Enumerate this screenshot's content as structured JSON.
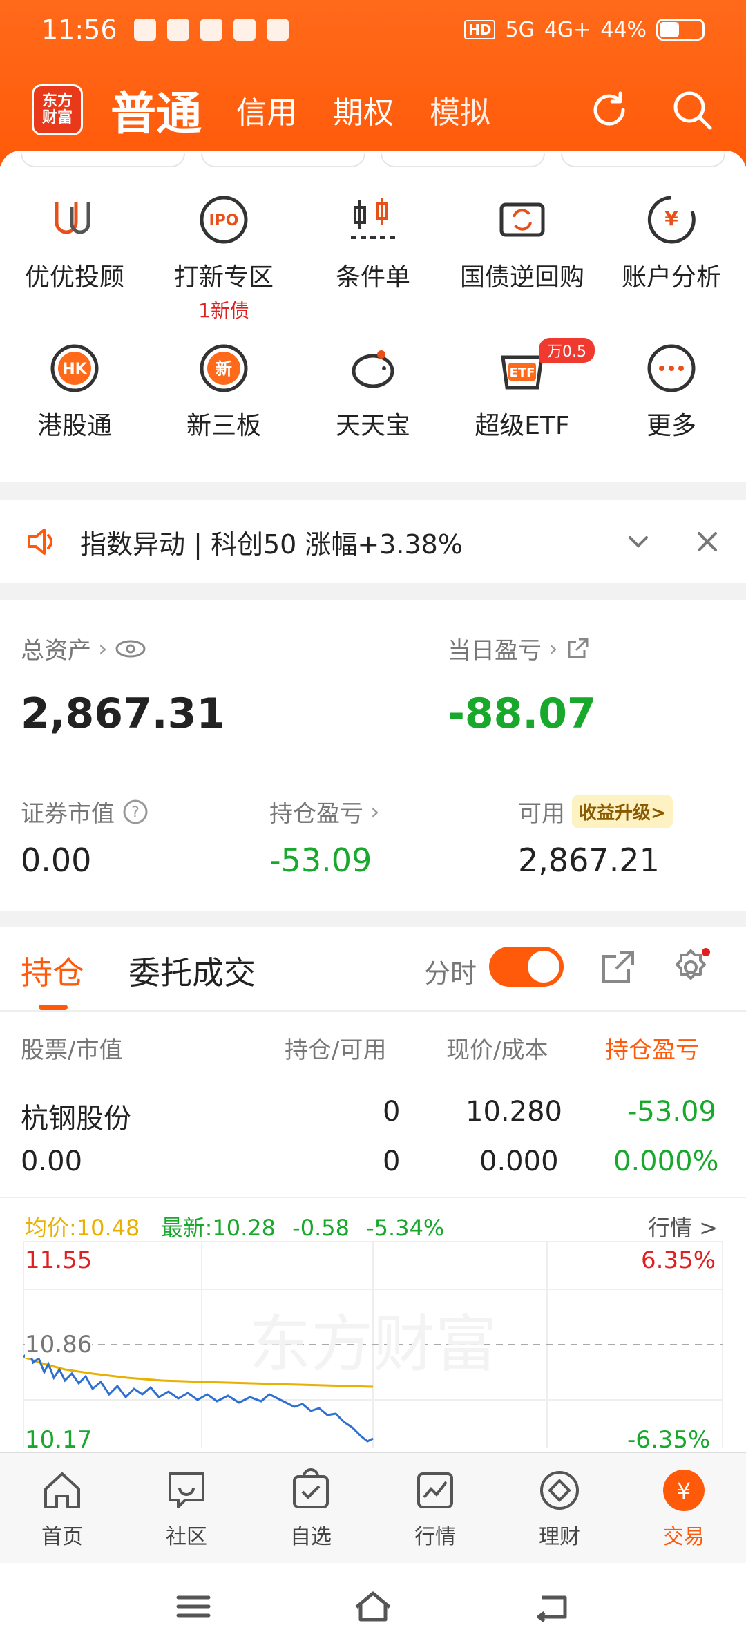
{
  "status_bar": {
    "time": "11:56",
    "network_hd": "HD",
    "network_5g": "5G",
    "network_4g": "4G+",
    "battery": "44%"
  },
  "header": {
    "logo_line1": "东方",
    "logo_line2": "财富",
    "tabs": [
      "普通",
      "信用",
      "期权",
      "模拟"
    ]
  },
  "features": [
    {
      "label": "优优投顾",
      "icon": "uu-advisor-icon"
    },
    {
      "label": "打新专区",
      "sub": "1新债",
      "icon": "ipo-icon"
    },
    {
      "label": "条件单",
      "icon": "candlestick-icon"
    },
    {
      "label": "国债逆回购",
      "icon": "repo-icon"
    },
    {
      "label": "账户分析",
      "icon": "yuan-chart-icon"
    },
    {
      "label": "港股通",
      "icon": "hk-icon"
    },
    {
      "label": "新三板",
      "icon": "new-board-icon"
    },
    {
      "label": "天天宝",
      "icon": "piggy-bank-icon"
    },
    {
      "label": "超级ETF",
      "badge": "万0.5",
      "icon": "etf-icon"
    },
    {
      "label": "更多",
      "icon": "more-icon"
    }
  ],
  "notice": {
    "text": "指数异动 | 科创50 涨幅+3.38%"
  },
  "assets": {
    "total_label": "总资产",
    "total_value": "2,867.31",
    "daily_label": "当日盈亏",
    "daily_value": "-88.07",
    "market_value_label": "证券市值",
    "market_value": "0.00",
    "position_pl_label": "持仓盈亏",
    "position_pl": "-53.09",
    "available_label": "可用",
    "available_value": "2,867.21",
    "upgrade_label": "收益升级>"
  },
  "positions": {
    "tab_active": "持仓",
    "tab_inactive": "委托成交",
    "toggle_label": "分时",
    "columns": [
      "股票/市值",
      "持仓/可用",
      "现价/成本",
      "持仓盈亏"
    ],
    "row": {
      "name": "杭钢股份",
      "market_value": "0.00",
      "holding": "0",
      "available": "0",
      "price": "10.280",
      "cost": "0.000",
      "pl": "-53.09",
      "pl_pct": "0.000%"
    }
  },
  "minichart": {
    "avg_label": "均价:",
    "avg_value": "10.48",
    "latest_label": "最新:",
    "latest_value": "10.28",
    "change": "-0.58",
    "change_pct": "-5.34%",
    "market_link": "行情 >",
    "top_price": "11.55",
    "top_pct": "6.35%",
    "mid_price": "10.86",
    "bottom_price": "10.17",
    "bottom_pct": "-6.35%",
    "watermark": "东方财富"
  },
  "bottom_nav": [
    {
      "label": "首页",
      "icon": "home-icon"
    },
    {
      "label": "社区",
      "icon": "community-icon"
    },
    {
      "label": "自选",
      "icon": "watchlist-icon"
    },
    {
      "label": "行情",
      "icon": "market-icon"
    },
    {
      "label": "理财",
      "icon": "wealth-icon"
    },
    {
      "label": "交易",
      "icon": "trade-icon"
    }
  ],
  "colors": {
    "brand": "#ff5a0a",
    "green": "#17a82c",
    "red": "#e02020"
  }
}
